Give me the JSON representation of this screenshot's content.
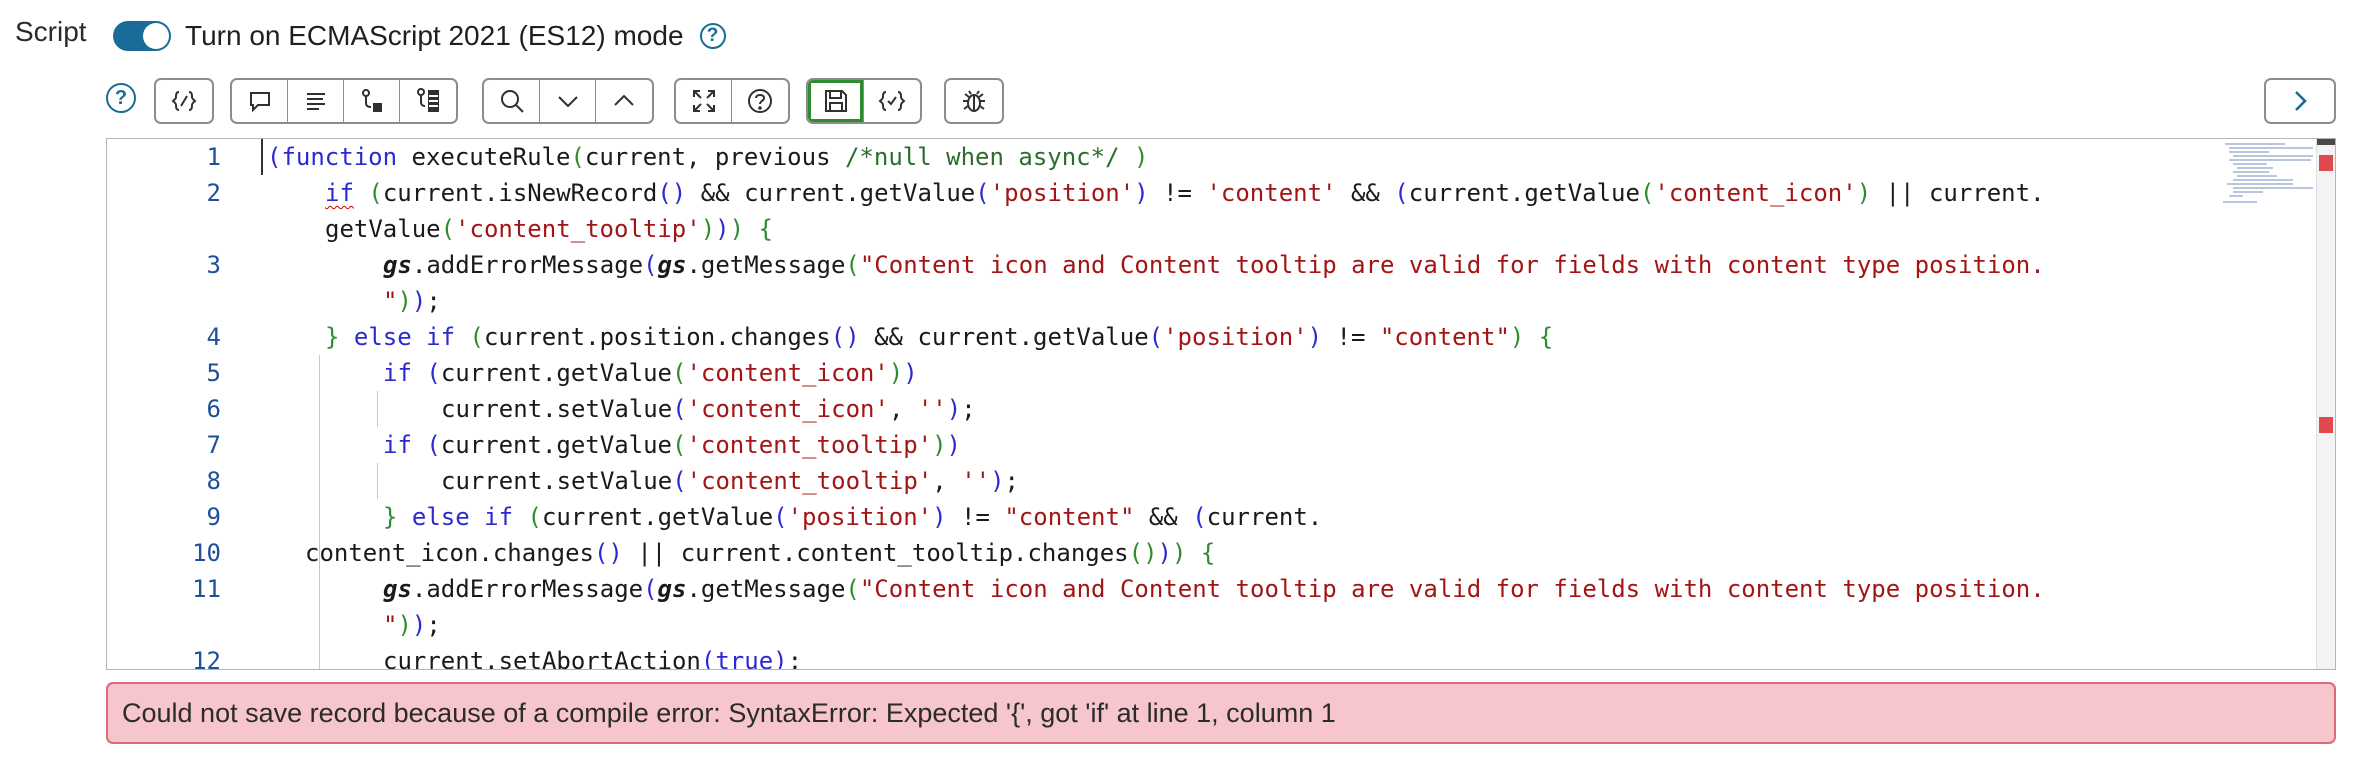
{
  "field": {
    "label": "Script"
  },
  "es_mode": {
    "label": "Turn on ECMAScript 2021 (ES12) mode",
    "help": "?",
    "enabled": true
  },
  "toolbar": {
    "help": "?",
    "groups": [
      [
        "script-include-icon"
      ],
      [
        "comment-icon",
        "format-icon",
        "replace-icon",
        "replace-all-icon"
      ],
      [
        "search-icon",
        "chevron-down-icon",
        "chevron-up-icon"
      ],
      [
        "fullscreen-icon",
        "help-icon"
      ],
      [
        "save-icon",
        "syntax-check-icon"
      ],
      [
        "debug-icon"
      ]
    ],
    "active": "save-icon",
    "next_icon": "chevron-right-icon"
  },
  "editor": {
    "line_numbers": [
      "1",
      "2",
      "",
      "3",
      "",
      "4",
      "5",
      "6",
      "7",
      "8",
      "9",
      "10",
      "11",
      "",
      "12"
    ],
    "code_lines": [
      "(function executeRule(current, previous /*null when async*/ )",
      "    if (current.isNewRecord() && current.getValue('position') != 'content' && (current.getValue('content_icon') || current.",
      "    getValue('content_tooltip'))) {",
      "        gs.addErrorMessage(gs.getMessage(\"Content icon and Content tooltip are valid for fields with content type position.",
      "        \"));",
      "    } else if (current.position.changes() && current.getValue('position') != \"content\") {",
      "        if (current.getValue('content_icon'))",
      "            current.setValue('content_icon', '');",
      "        if (current.getValue('content_tooltip'))",
      "            current.setValue('content_tooltip', '');",
      "        } else if (current.getValue('position') != \"content\" && (current.",
      "   content_icon.changes() || current.content_tooltip.changes())) {",
      "        gs.addErrorMessage(gs.getMessage(\"Content icon and Content tooltip are valid for fields with content type position.",
      "        \"));",
      "        current.setAbortAction(true);"
    ]
  },
  "error": {
    "message": "Could not save record because of a compile error: SyntaxError: Expected '{', got 'if' at line 1, column 1"
  },
  "colors": {
    "accent": "#1a6c98",
    "active_border": "#2e8b2e",
    "error_bg": "#f6c6cc",
    "error_border": "#d96b77",
    "error_mark": "#e0494d"
  }
}
